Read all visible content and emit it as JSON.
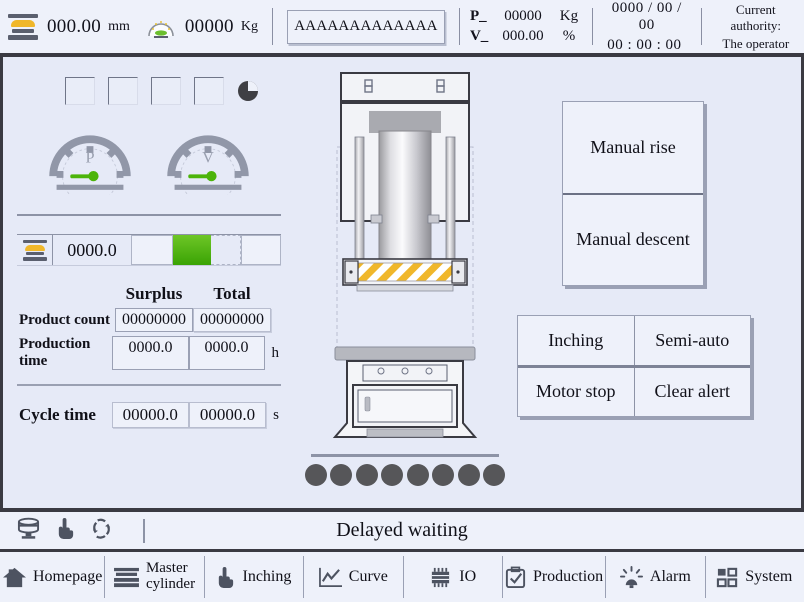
{
  "header": {
    "stroke": {
      "icon": "press-stack-icon",
      "value": "000.00",
      "unit": "mm"
    },
    "force": {
      "icon": "gauge-icon",
      "value": "00000",
      "unit": "Kg"
    },
    "name_field": {
      "value": "AAAAAAAAAAAAA"
    },
    "pressure": {
      "key": "P_",
      "value": "00000",
      "unit": "Kg"
    },
    "velocity": {
      "key": "V_",
      "value": "000.00",
      "unit": "%"
    },
    "date": "0000 / 00 / 00",
    "time": "00 : 00 : 00",
    "authority": {
      "label": "Current authority:",
      "value": "The operator"
    }
  },
  "left": {
    "indicators": [
      "",
      "",
      "",
      ""
    ],
    "pie_icon": "pie-chart-icon",
    "gauges": [
      {
        "name": "pressure-gauge",
        "label": "P"
      },
      {
        "name": "velocity-gauge",
        "label": "V"
      }
    ],
    "bar": {
      "icon": "press-stack-icon",
      "value": "0000.0",
      "fill_color": "#4cb40a"
    },
    "stats": {
      "col_surplus": "Surplus",
      "col_total": "Total",
      "rows": [
        {
          "label": "Product count",
          "surplus": "00000000",
          "total": "00000000",
          "unit": ""
        },
        {
          "label": "Production time",
          "surplus": "0000.0",
          "total": "0000.0",
          "unit": "h"
        }
      ],
      "cycle": {
        "label": "Cycle time",
        "surplus": "00000.0",
        "total": "00000.0",
        "unit": "s"
      }
    },
    "dot_count": 8
  },
  "right": {
    "manual": [
      {
        "name": "manual-rise-button",
        "label": "Manual rise"
      },
      {
        "name": "manual-descent-button",
        "label": "Manual descent"
      }
    ],
    "quad": [
      {
        "name": "inching-button",
        "label": "Inching"
      },
      {
        "name": "semi-auto-button",
        "label": "Semi-auto"
      },
      {
        "name": "motor-stop-button",
        "label": "Motor stop"
      },
      {
        "name": "clear-alert-button",
        "label": "Clear alert"
      }
    ]
  },
  "statusbar": {
    "icons": [
      "motor-icon",
      "hand-pointer-icon",
      "cycle-arrows-icon"
    ],
    "message": "Delayed waiting"
  },
  "tabs": [
    {
      "name": "tab-homepage",
      "icon": "home-icon",
      "label": "Homepage"
    },
    {
      "name": "tab-master-cylinder",
      "icon": "press-stack-icon",
      "label": "Master\ncylinder"
    },
    {
      "name": "tab-inching",
      "icon": "hand-pointer-icon",
      "label": "Inching"
    },
    {
      "name": "tab-curve",
      "icon": "chart-curve-icon",
      "label": "Curve"
    },
    {
      "name": "tab-io",
      "icon": "chip-icon",
      "label": "IO"
    },
    {
      "name": "tab-production",
      "icon": "clipboard-check-icon",
      "label": "Production"
    },
    {
      "name": "tab-alarm",
      "icon": "alarm-beacon-icon",
      "label": "Alarm"
    },
    {
      "name": "tab-system",
      "icon": "grid-squares-icon",
      "label": "System"
    }
  ],
  "colors": {
    "panel_bg": "#e6eaf7",
    "chrome_bg": "#eef1fa",
    "border_dark": "#3a3a42",
    "accent_green": "#4cb40a",
    "accent_yellow": "#f0b72a"
  }
}
